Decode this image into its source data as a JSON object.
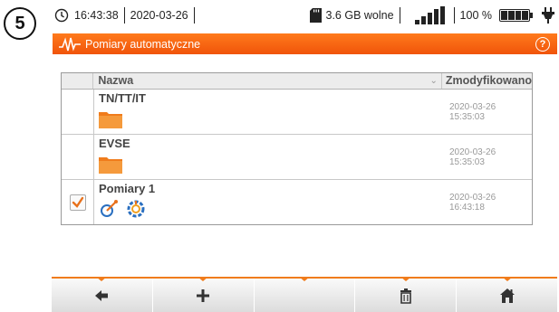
{
  "step_badge": "5",
  "statusbar": {
    "time": "16:43:38",
    "date": "2020-03-26",
    "storage": "3.6 GB wolne",
    "battery": "100 %"
  },
  "titlebar": {
    "title": "Pomiary automatyczne",
    "help": "?"
  },
  "table": {
    "columns": {
      "name": "Nazwa",
      "modified": "Zmodyfikowano"
    },
    "rows": [
      {
        "name": "TN/TT/IT",
        "modified": "2020-03-26 15:35:03",
        "icon": "folder-icon",
        "checked": false
      },
      {
        "name": "EVSE",
        "modified": "2020-03-26 15:35:03",
        "icon": "folder-icon",
        "checked": false
      },
      {
        "name": "Pomiary 1",
        "modified": "2020-03-26 16:43:18",
        "icon": "measurement-icons",
        "checked": true
      }
    ]
  },
  "bottombar": {
    "buttons": [
      "back-arrow-icon",
      "add-icon",
      "empty",
      "delete-icon",
      "home-icon"
    ]
  },
  "colors": {
    "accent": "#f06a14",
    "checkmark": "#e8711c",
    "date_text": "#999999"
  }
}
